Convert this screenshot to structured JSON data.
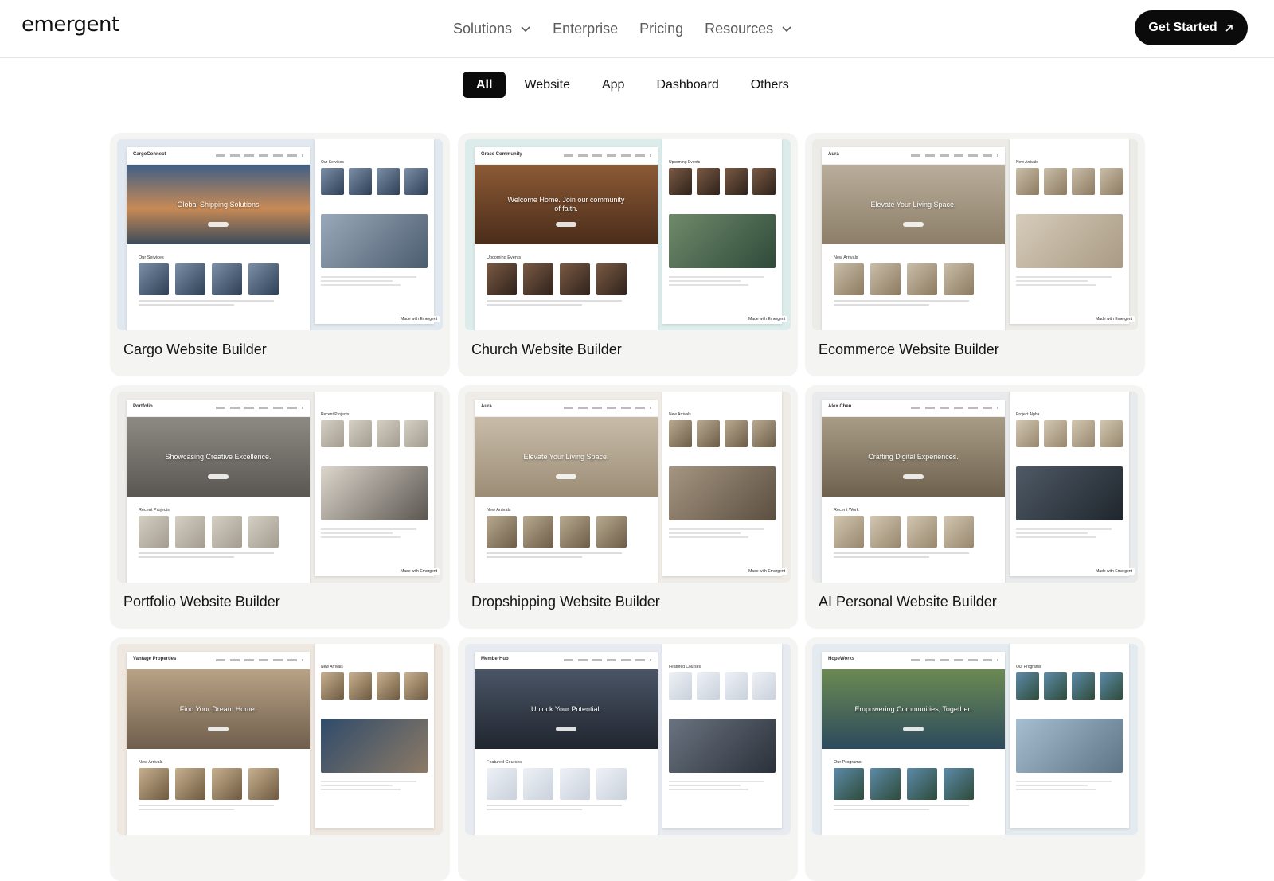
{
  "header": {
    "logo": "emergent",
    "nav": [
      {
        "label": "Solutions",
        "dropdown": true
      },
      {
        "label": "Enterprise",
        "dropdown": false
      },
      {
        "label": "Pricing",
        "dropdown": false
      },
      {
        "label": "Resources",
        "dropdown": true
      }
    ],
    "cta_label": "Get Started"
  },
  "filters": {
    "items": [
      "All",
      "Website",
      "App",
      "Dashboard",
      "Others"
    ],
    "active": "All"
  },
  "cards": [
    {
      "title": "Cargo Website Builder",
      "theme": "t-cargo",
      "brand": "CargoConnect",
      "hero": "Global Shipping Solutions",
      "section": "Our Services",
      "side_section": "Our Services",
      "badge": "Made with Emergent"
    },
    {
      "title": "Church Website Builder",
      "theme": "t-church",
      "brand": "Grace Community",
      "hero": "Welcome Home. Join our community of faith.",
      "section": "Upcoming Events",
      "side_section": "Upcoming Events",
      "badge": "Made with Emergent"
    },
    {
      "title": "Ecommerce Website Builder",
      "theme": "t-ecom",
      "brand": "Aura",
      "hero": "Elevate Your Living Space.",
      "section": "New Arrivals",
      "side_section": "New Arrivals",
      "badge": "Made with Emergent"
    },
    {
      "title": "Portfolio Website Builder",
      "theme": "t-port",
      "brand": "Portfolio",
      "hero": "Showcasing Creative Excellence.",
      "section": "Recent Projects",
      "side_section": "Recent Projects",
      "badge": "Made with Emergent"
    },
    {
      "title": "Dropshipping Website Builder",
      "theme": "t-drop",
      "brand": "Aura",
      "hero": "Elevate Your Living Space.",
      "section": "New Arrivals",
      "side_section": "New Arrivals",
      "badge": "Made with Emergent"
    },
    {
      "title": "AI Personal Website Builder",
      "theme": "t-ai",
      "brand": "Alex Chen",
      "hero": "Crafting Digital Experiences.",
      "section": "Recent Work",
      "side_section": "Project Alpha",
      "badge": "Made with Emergent"
    },
    {
      "title": "",
      "theme": "t-real",
      "brand": "Vantage Properties",
      "hero": "Find Your Dream Home.",
      "section": "New Arrivals",
      "side_section": "New Arrivals",
      "badge": ""
    },
    {
      "title": "",
      "theme": "t-member",
      "brand": "MemberHub",
      "hero": "Unlock Your Potential.",
      "section": "Featured Courses",
      "side_section": "Featured Courses",
      "badge": ""
    },
    {
      "title": "",
      "theme": "t-hope",
      "brand": "HopeWorks",
      "hero": "Empowering Communities, Together.",
      "section": "Our Programs",
      "side_section": "Our Programs",
      "badge": ""
    }
  ]
}
